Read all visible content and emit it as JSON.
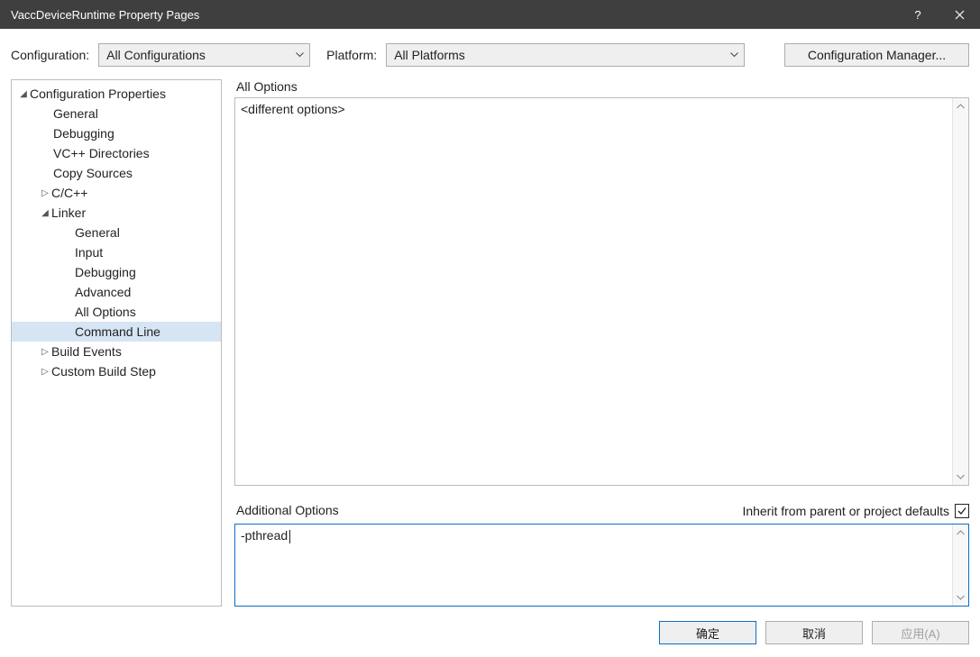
{
  "window": {
    "title": "VaccDeviceRuntime Property Pages"
  },
  "toolbar": {
    "configuration_label": "Configuration:",
    "configuration_value": "All Configurations",
    "platform_label": "Platform:",
    "platform_value": "All Platforms",
    "config_manager_label": "Configuration Manager..."
  },
  "tree": {
    "root": {
      "label": "Configuration Properties"
    },
    "items": [
      {
        "label": "General"
      },
      {
        "label": "Debugging"
      },
      {
        "label": "VC++ Directories"
      },
      {
        "label": "Copy Sources"
      },
      {
        "label": "C/C++"
      },
      {
        "label": "Linker"
      },
      {
        "label": "Build Events"
      },
      {
        "label": "Custom Build Step"
      }
    ],
    "linker_children": [
      {
        "label": "General"
      },
      {
        "label": "Input"
      },
      {
        "label": "Debugging"
      },
      {
        "label": "Advanced"
      },
      {
        "label": "All Options"
      },
      {
        "label": "Command Line"
      }
    ]
  },
  "right": {
    "all_options_label": "All Options",
    "all_options_value": "<different options>",
    "inherit_label": "Inherit from parent or project defaults",
    "additional_label": "Additional Options",
    "additional_value": "-pthread"
  },
  "buttons": {
    "ok": "确定",
    "cancel": "取消",
    "apply": "应用(A)"
  }
}
